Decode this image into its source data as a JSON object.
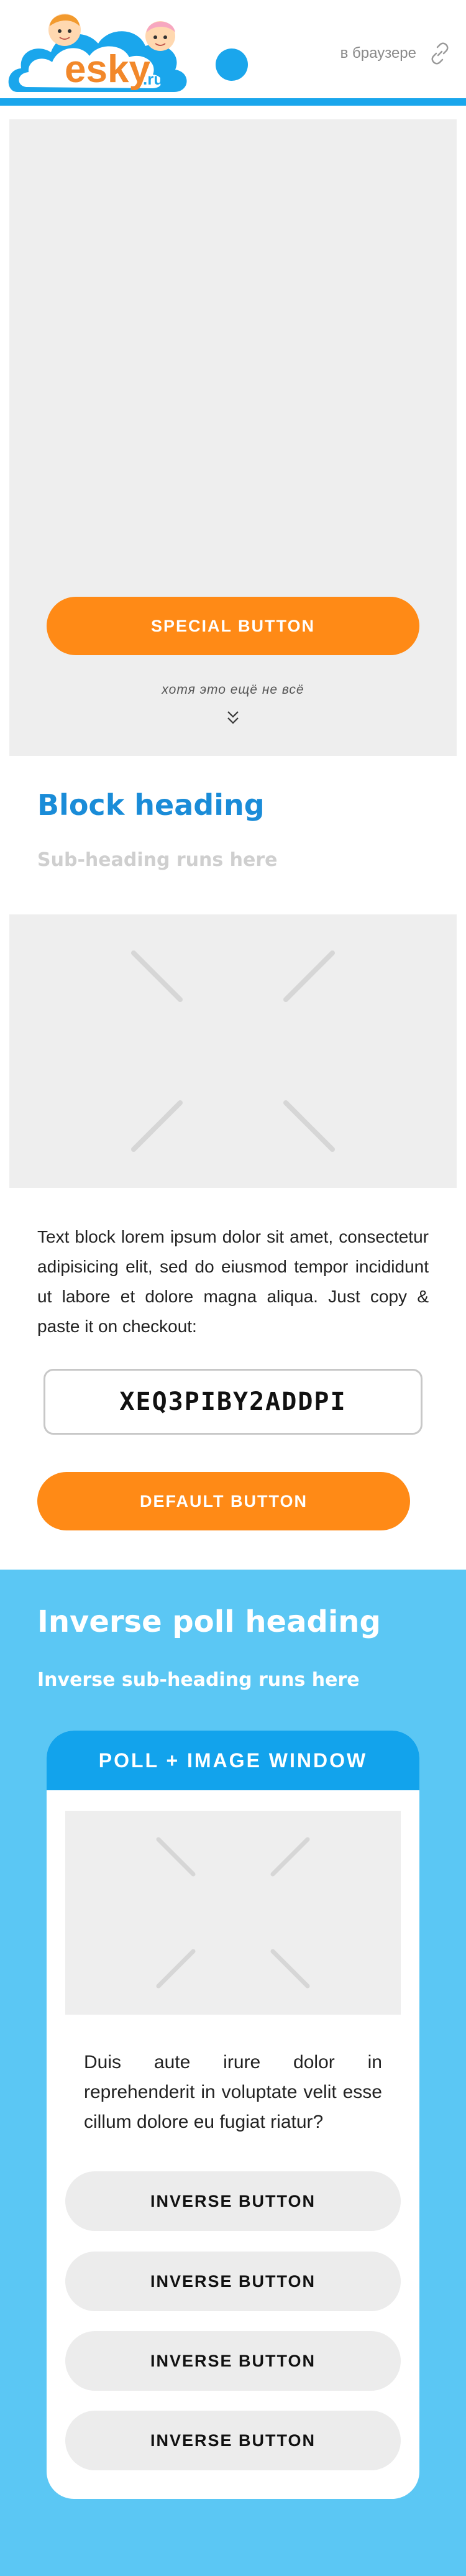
{
  "header": {
    "logo_text": "esky",
    "logo_domain": ".ru",
    "browser_link": "в браузере",
    "icons": {
      "link": "link-icon",
      "logo": "esky-logo"
    },
    "colors": {
      "accent": "#1aa6ec"
    }
  },
  "hero": {
    "special_button": "SPECIAL BUTTON",
    "hint": "хотя это ещё не всё",
    "icons": {
      "more": "double-chevron-down-icon"
    }
  },
  "block": {
    "heading": "Block heading",
    "sub_heading": "Sub-heading runs here"
  },
  "text_block": {
    "body": "Text block lorem ipsum dolor sit amet, consectetur adipisicing elit, sed do eiusmod tempor incididunt ut labore et dolore magna aliqua. Just copy & paste it on checkout:",
    "coupon_code": "XEQ3PIBY2ADDPI",
    "default_button": "DEFAULT BUTTON"
  },
  "inverse": {
    "heading": "Inverse poll heading",
    "sub_heading": "Inverse sub-heading runs here",
    "poll_window_title": "POLL + IMAGE WINDOW",
    "poll_text": "Duis aute irure dolor in reprehenderit in voluptate velit esse cillum dolore eu fugiat riatur?",
    "buttons": [
      "INVERSE BUTTON",
      "INVERSE BUTTON",
      "INVERSE BUTTON",
      "INVERSE BUTTON"
    ],
    "colors": {
      "background": "#5bc7f4",
      "window_header": "#12a3ec",
      "primary_button": "#ff8a16"
    }
  }
}
